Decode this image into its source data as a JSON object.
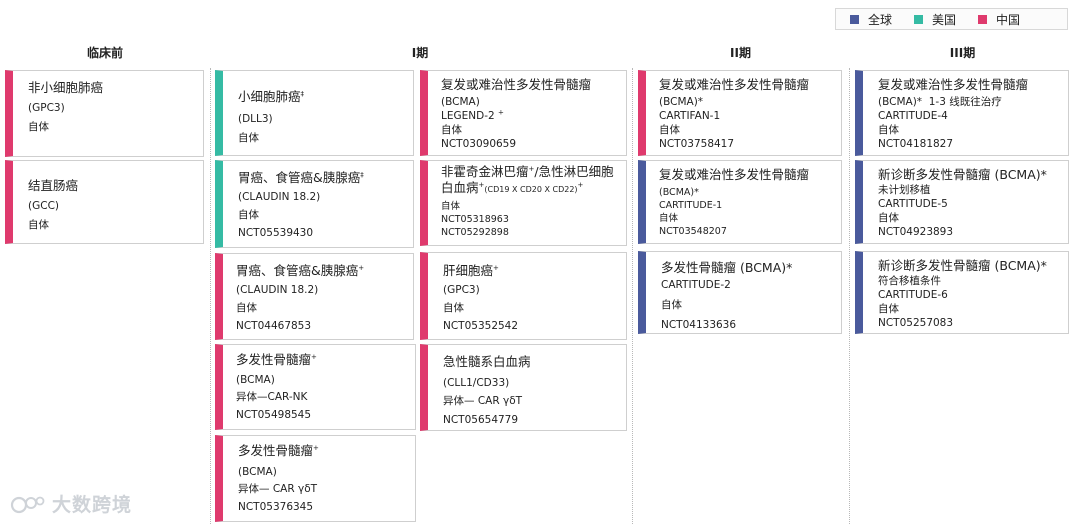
{
  "legend": [
    {
      "label": "全球",
      "color": "#4a5a9c"
    },
    {
      "label": "美国",
      "color": "#35bba4"
    },
    {
      "label": "中国",
      "color": "#df3a6d"
    }
  ],
  "columns": {
    "preclinical": "临床前",
    "phase1": "I期",
    "phase2": "II期",
    "phase3": "III期"
  },
  "cards": {
    "p0": {
      "name": "非小细胞肺癌",
      "target": "(GPC3)",
      "type": "自体"
    },
    "p1": {
      "name": "结直肠癌",
      "target": "(GCC)",
      "type": "自体"
    },
    "a0": {
      "name": "小细胞肺癌",
      "mark": "‡",
      "target": "(DLL3)",
      "type": "自体"
    },
    "a1": {
      "name": "胃癌、食管癌&胰腺癌",
      "mark": "‡",
      "target": "(CLAUDIN 18.2)",
      "type": "自体",
      "nct": "NCT05539430"
    },
    "a2": {
      "name": "胃癌、食管癌&胰腺癌",
      "mark": "+",
      "target": "(CLAUDIN 18.2)",
      "type": "自体",
      "nct": "NCT04467853"
    },
    "a3": {
      "name": "多发性骨髓瘤",
      "mark": "+",
      "target": "(BCMA)",
      "type": "异体—CAR-NK",
      "nct": "NCT05498545"
    },
    "a4": {
      "name": "多发性骨髓瘤",
      "mark": "+",
      "target": "(BCMA)",
      "type": "异体— CAR γδT",
      "nct": "NCT05376345"
    },
    "b0": {
      "name": "复发或难治性多发性骨髓瘤",
      "target": "(BCMA)",
      "trial": "LEGEND-2",
      "mark": "+",
      "type": "自体",
      "nct": "NCT03090659"
    },
    "b1": {
      "name1": "非霍奇金淋巴瘤",
      "mark1": "+",
      "name2": "/急性淋巴细胞",
      "name3": "白血病",
      "mark3": "+",
      "detail": "(CD19 X CD20 X CD22)",
      "mark4": "+",
      "type": "自体",
      "nct1": "NCT05318963",
      "nct2": "NCT05292898"
    },
    "b2": {
      "name": "肝细胞癌",
      "mark": "+",
      "target": "(GPC3)",
      "type": "自体",
      "nct": "NCT05352542"
    },
    "b3": {
      "name": "急性髓系白血病",
      "target": "(CLL1/CD33)",
      "type": "异体— CAR γδT",
      "nct": "NCT05654779"
    },
    "c0": {
      "name": "复发或难治性多发性骨髓瘤",
      "target": "(BCMA)*",
      "trial": "CARTIFAN-1",
      "type": "自体",
      "nct": "NCT03758417"
    },
    "c1": {
      "name": "复发或难治性多发性骨髓瘤",
      "target": "(BCMA)*",
      "trial": "CARTITUDE-1",
      "type": "自体",
      "nct": "NCT03548207"
    },
    "c2": {
      "name": "多发性骨髓瘤 (BCMA)*",
      "trial": "CARTITUDE-2",
      "type": "自体",
      "nct": "NCT04133636"
    },
    "d0": {
      "name": "复发或难治性多发性骨髓瘤",
      "target": "(BCMA)*",
      "note": "1-3 线既往治疗",
      "trial": "CARTITUDE-4",
      "type": "自体",
      "nct": "NCT04181827"
    },
    "d1": {
      "name": "新诊断多发性骨髓瘤 (BCMA)*",
      "note": "未计划移植",
      "trial": "CARTITUDE-5",
      "type": "自体",
      "nct": "NCT04923893"
    },
    "d2": {
      "name": "新诊断多发性骨髓瘤 (BCMA)*",
      "note": "符合移植条件",
      "trial": "CARTITUDE-6",
      "type": "自体",
      "nct": "NCT05257083"
    }
  },
  "watermark": "大数跨境"
}
